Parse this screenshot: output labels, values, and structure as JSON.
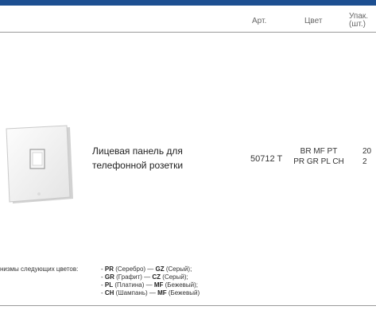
{
  "header": {
    "col_art": "Арт.",
    "col_color": "Цвет",
    "col_pack": "Упак. (шт.)"
  },
  "product": {
    "name": "Лицевая панель для телефонной розетки",
    "art": "50712 T",
    "colors_line1": "BR MF PT",
    "colors_line2": "PR GR PL CH",
    "pack_line1": "20",
    "pack_line2": "2"
  },
  "legend": {
    "lead": "низмы следующих цветов:",
    "lines": [
      {
        "prefix": "- ",
        "code1": "PR",
        "name1": " (Серебро) — ",
        "code2": "GZ",
        "name2": " (Серый);"
      },
      {
        "prefix": "- ",
        "code1": "GR",
        "name1": " (Графит) — ",
        "code2": "CZ",
        "name2": " (Серый);"
      },
      {
        "prefix": "- ",
        "code1": "PL",
        "name1": " (Платина) — ",
        "code2": "MF",
        "name2": " (Бежевый);"
      },
      {
        "prefix": "- ",
        "code1": "CH",
        "name1": " (Шампань) — ",
        "code2": "MF",
        "name2": " (Бежевый)"
      }
    ]
  },
  "colors": {
    "top_bar": "#1d4f91",
    "rule": "#9a9a9a"
  }
}
